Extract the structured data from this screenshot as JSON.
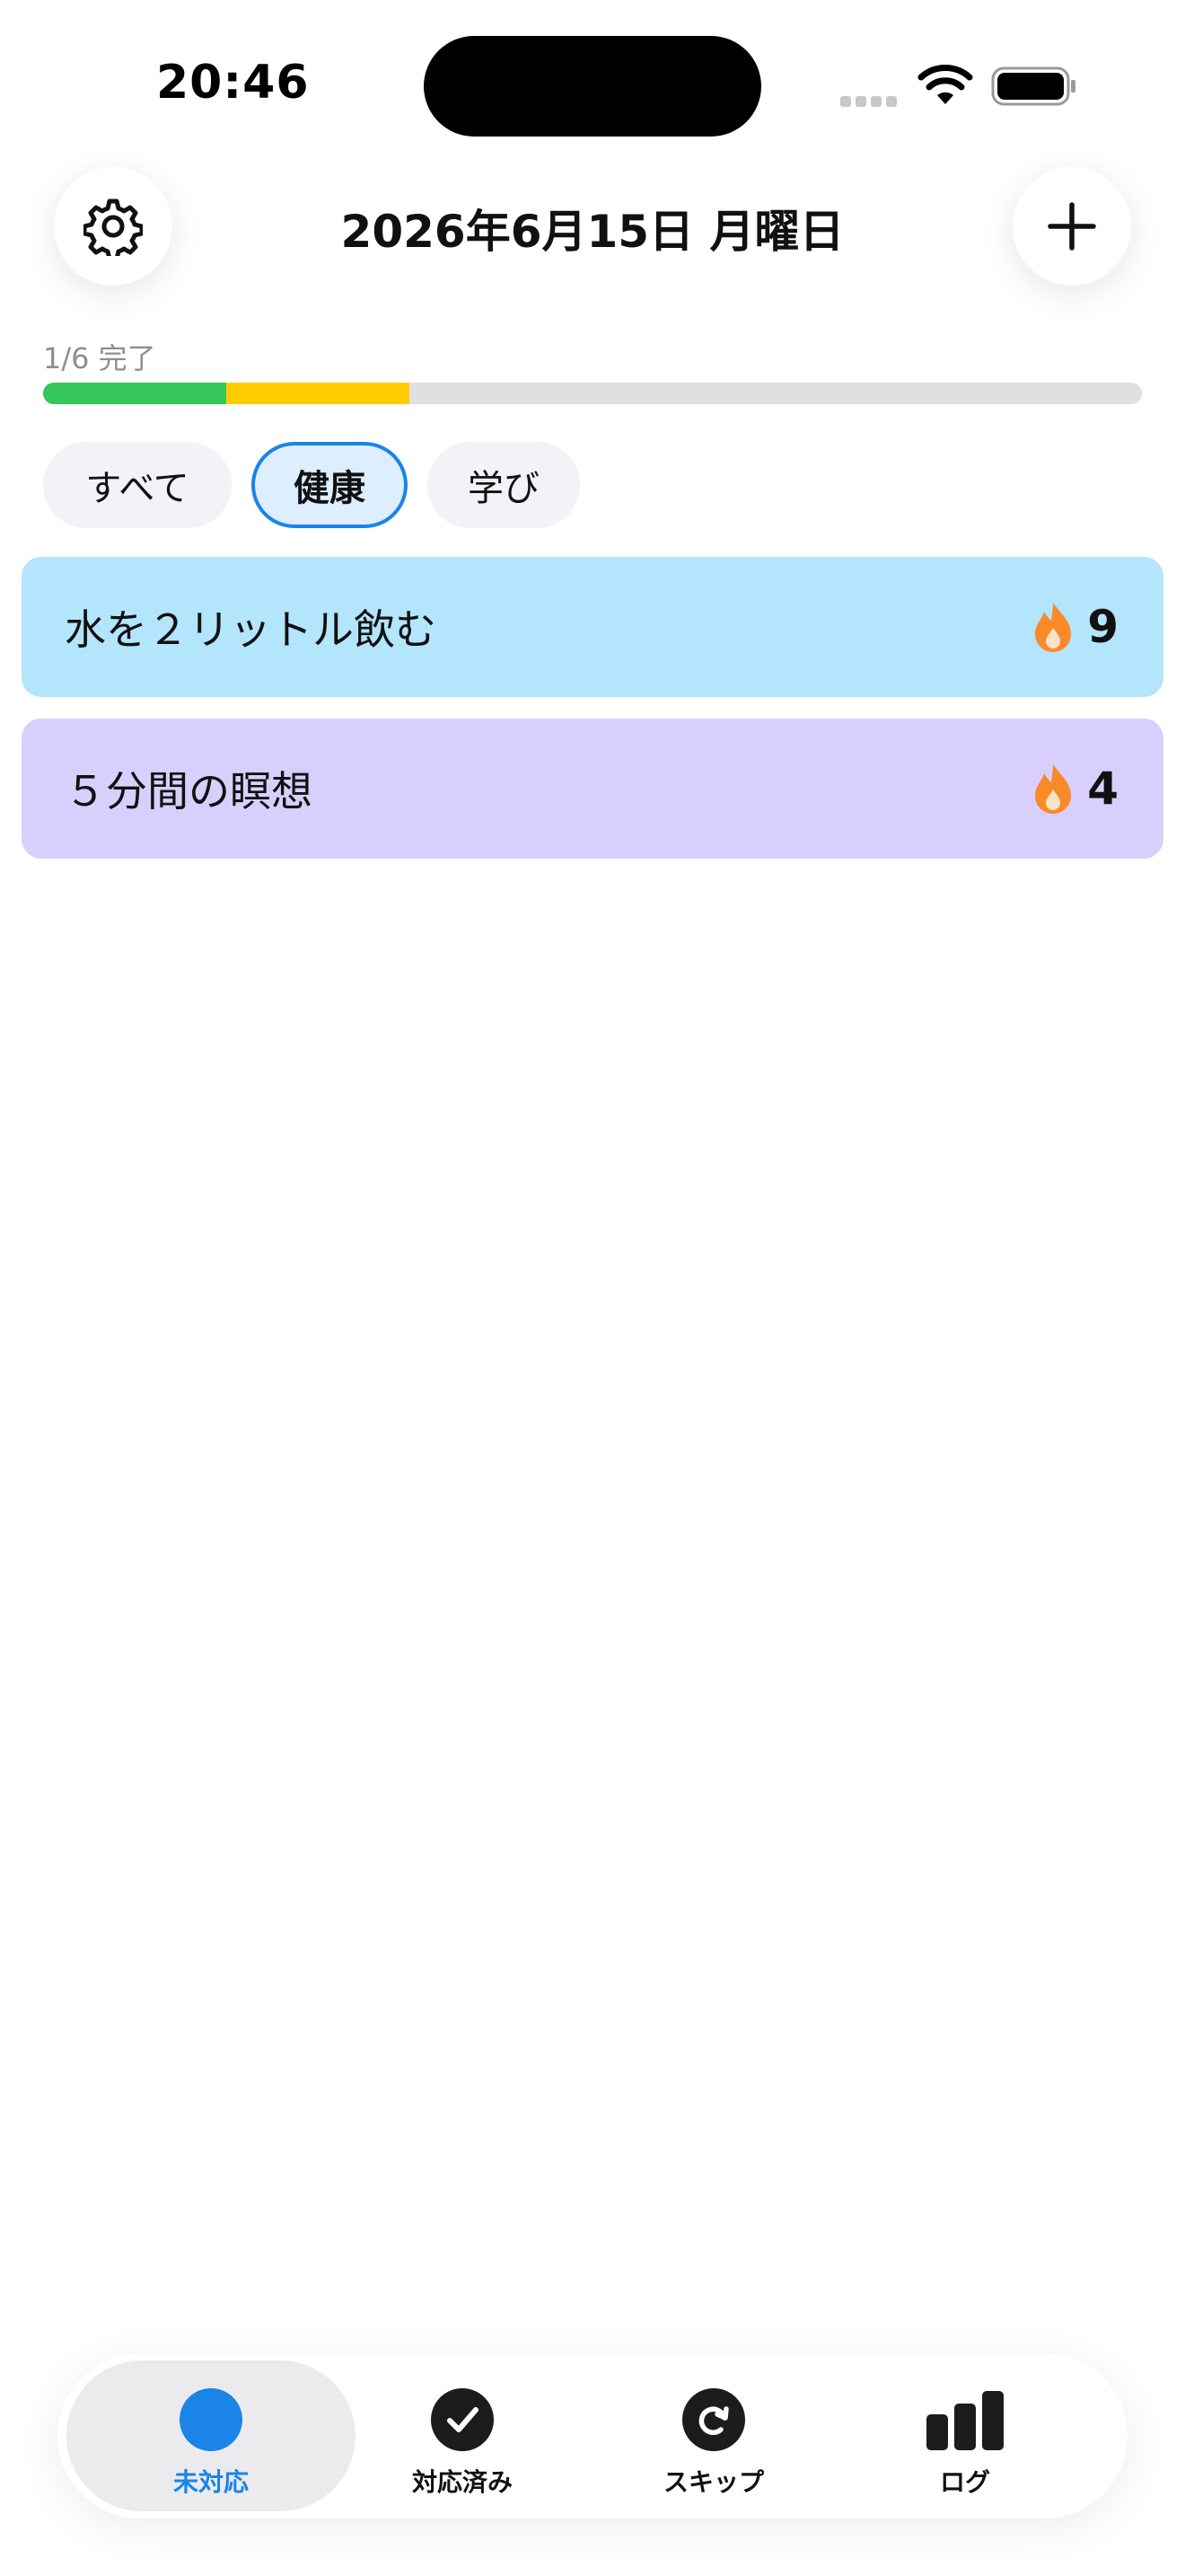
{
  "status_bar": {
    "time": "20:46"
  },
  "header": {
    "title": "2026年6月15日 月曜日",
    "settings_icon": "gear-icon",
    "add_icon": "plus-icon"
  },
  "progress": {
    "label": "1/6 完了",
    "segments": [
      {
        "color": "#34c759",
        "fraction": 0.1667
      },
      {
        "color": "#ffcc00",
        "fraction": 0.1667
      }
    ],
    "track_color": "#e0e0e0"
  },
  "filters": {
    "all": "すべて",
    "health": "健康",
    "learning": "学び",
    "selected": "健康"
  },
  "habits": [
    {
      "name": "水を２リットル飲む",
      "streak": "9",
      "color": "#b3e5fc"
    },
    {
      "name": "５分間の瞑想",
      "streak": "4",
      "color": "#d9cffc"
    }
  ],
  "tabbar": {
    "pending": "未対応",
    "done": "対応済み",
    "skip": "スキップ",
    "log": "ログ",
    "active": "未対応",
    "accent": "#1a84e8"
  }
}
